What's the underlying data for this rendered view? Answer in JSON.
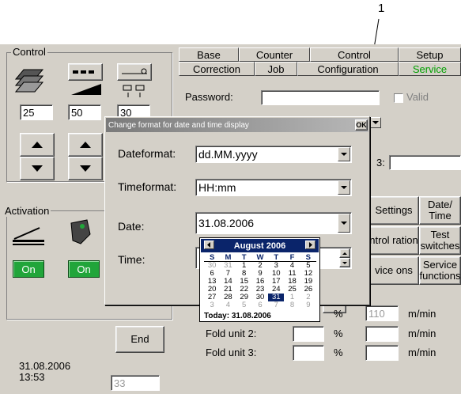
{
  "callout": "1",
  "colors": {
    "panel": "#d4d0c8",
    "on_button": "#21a53a",
    "calendar_header": "#0a246a",
    "service_tab": "#00a000"
  },
  "control": {
    "title": "Control",
    "values": [
      "25",
      "50",
      "30"
    ]
  },
  "activation": {
    "title": "Activation",
    "on_buttons": [
      "On",
      "On"
    ]
  },
  "tabs": {
    "row1": [
      "Base",
      "Counter",
      "Control",
      "Setup"
    ],
    "row2": [
      "Correction",
      "Job",
      "Configuration",
      "Service"
    ]
  },
  "password": {
    "label": "Password:",
    "value": "",
    "valid_label": "Valid"
  },
  "field3_label": "3:",
  "service_buttons": {
    "settings": "Settings",
    "date_time": "Date/ Time",
    "control_operation": "ntrol ration",
    "test_switches": "Test switches",
    "service_options": "vice ons",
    "service_functions": "Service functions"
  },
  "ok_partial": "K",
  "end_button": "End",
  "status": {
    "datetime": "31.08.2006\n13:53",
    "counter": "33"
  },
  "fold_units": [
    {
      "label": "Fold unit 2:",
      "value": "",
      "unit_pct": "%",
      "speed": "",
      "unit_speed": "m/min"
    },
    {
      "label": "Fold unit 3:",
      "value": "",
      "unit_pct": "%",
      "speed": "",
      "unit_speed": "m/min"
    }
  ],
  "fold_unit1": {
    "unit_pct": "%",
    "speed": "110",
    "unit_speed": "m/min"
  },
  "dialog": {
    "title": "Change format for date and time display",
    "ok": "OK",
    "dateformat_label": "Dateformat:",
    "dateformat_value": "dd.MM.yyyy",
    "timeformat_label": "Timeformat:",
    "timeformat_value": "HH:mm",
    "date_label": "Date:",
    "date_value": "31.08.2006",
    "time_label": "Time:"
  },
  "calendar": {
    "month": "August 2006",
    "dow": [
      "S",
      "M",
      "T",
      "W",
      "T",
      "F",
      "S"
    ],
    "weeks": [
      [
        "30",
        "31",
        "1",
        "2",
        "3",
        "4",
        "5"
      ],
      [
        "6",
        "7",
        "8",
        "9",
        "10",
        "11",
        "12"
      ],
      [
        "13",
        "14",
        "15",
        "16",
        "17",
        "18",
        "19"
      ],
      [
        "20",
        "21",
        "22",
        "23",
        "24",
        "25",
        "26"
      ],
      [
        "27",
        "28",
        "29",
        "30",
        "31",
        "1",
        "2"
      ],
      [
        "3",
        "4",
        "5",
        "6",
        "7",
        "8",
        "9"
      ]
    ],
    "selected": "31",
    "today": "Today: 31.08.2006"
  }
}
